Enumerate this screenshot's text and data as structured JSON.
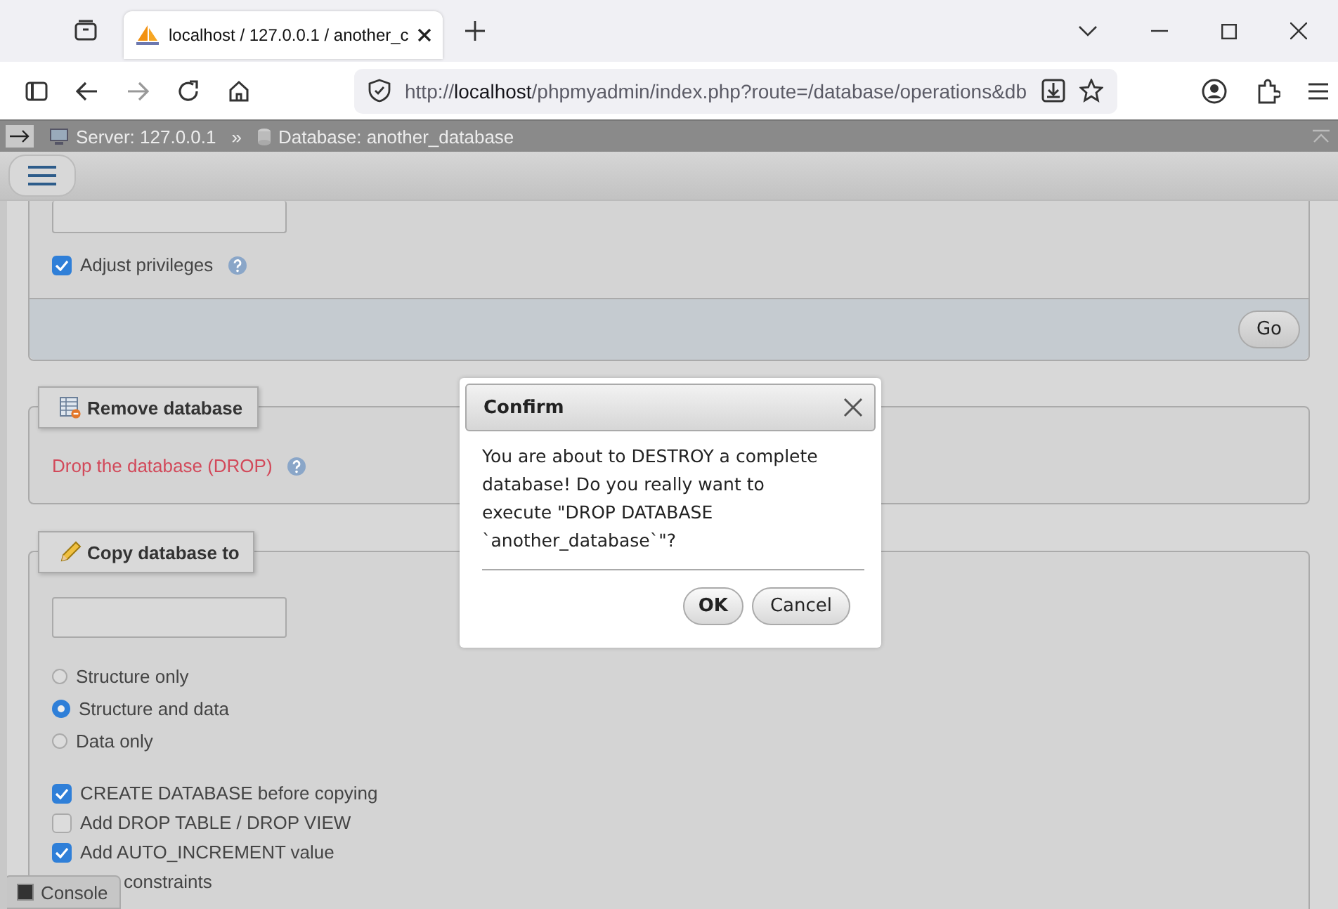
{
  "browser": {
    "tab_title": "localhost / 127.0.0.1 / another_c",
    "url": {
      "scheme": "http://",
      "host": "localhost",
      "path": "/phpmyadmin/index.php?route=/database/operations&db"
    }
  },
  "breadcrumb": {
    "server": "Server: 127.0.0.1",
    "separator": "»",
    "database": "Database: another_database"
  },
  "rename_section": {
    "checkboxes": [
      {
        "label": "Adjust privileges",
        "checked": true
      }
    ],
    "button": "Go"
  },
  "remove_section": {
    "title": "Remove database",
    "link": "Drop the database (DROP)"
  },
  "copy_section": {
    "title": "Copy database to",
    "radios": [
      {
        "label": "Structure only",
        "selected": false
      },
      {
        "label": "Structure and data",
        "selected": true
      },
      {
        "label": "Data only",
        "selected": false
      }
    ],
    "checkboxes": [
      {
        "label": "CREATE DATABASE before copying",
        "checked": true
      },
      {
        "label": "Add DROP TABLE / DROP VIEW",
        "checked": false
      },
      {
        "label": "Add AUTO_INCREMENT value",
        "checked": true
      },
      {
        "label": "constraints"
      }
    ]
  },
  "dialog": {
    "title": "Confirm",
    "message": "You are about to DESTROY a complete database! Do you really want to execute \"DROP DATABASE `another_database`\"?",
    "buttons": [
      {
        "label": "OK",
        "kind": "primary"
      },
      {
        "label": "Cancel",
        "kind": "secondary"
      }
    ]
  },
  "console": {
    "label": "Console"
  }
}
